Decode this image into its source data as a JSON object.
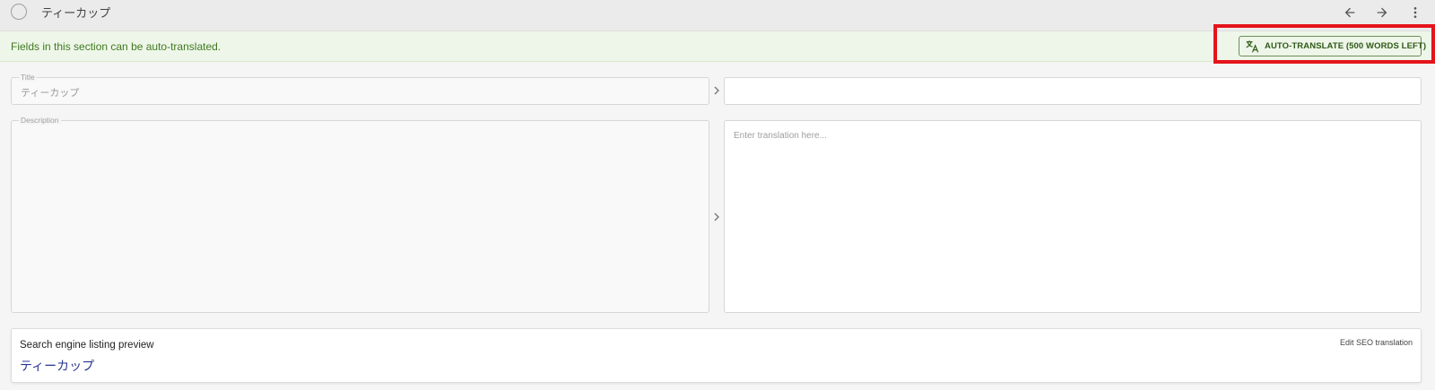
{
  "header": {
    "title": "ティーカップ",
    "back_icon": "arrow-left-icon",
    "forward_icon": "arrow-right-icon",
    "more_icon": "more-vert-icon"
  },
  "notice": {
    "text": "Fields in this section can be auto-translated.",
    "button_label": "AUTO-TRANSLATE (500 WORDS LEFT)",
    "button_icon": "translate-icon",
    "highlight_color": "#e4141b"
  },
  "fields": {
    "title": {
      "label": "Title",
      "source_value": "ティーカップ",
      "translation_value": ""
    },
    "description": {
      "label": "Description",
      "source_value": "",
      "translation_placeholder": "Enter translation here..."
    }
  },
  "seo": {
    "heading": "Search engine listing preview",
    "edit_label": "Edit SEO translation",
    "preview_title": "ティーカップ"
  },
  "colors": {
    "accent_green": "#3f7a1f",
    "link_blue": "#283593"
  }
}
